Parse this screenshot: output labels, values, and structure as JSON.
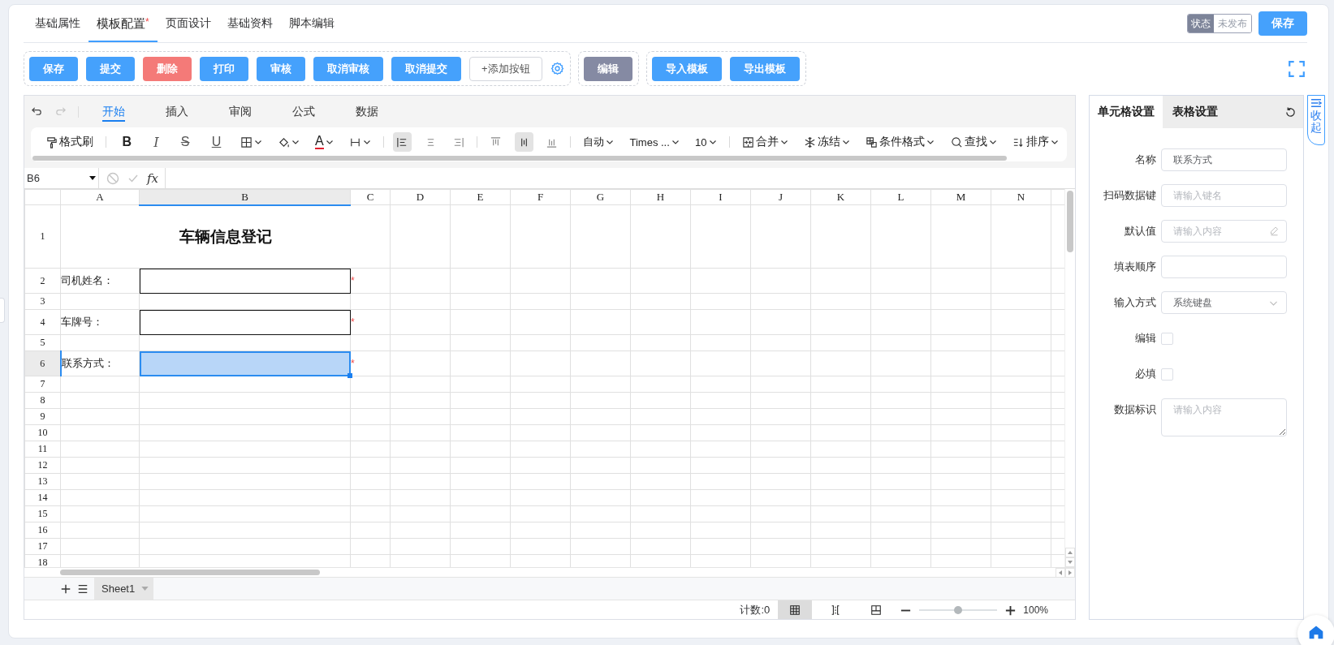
{
  "top_tabs": [
    {
      "label": "基础属性",
      "selected": false
    },
    {
      "label": "模板配置",
      "mark": "*",
      "selected": true
    },
    {
      "label": "页面设计",
      "selected": false
    },
    {
      "label": "基础资料",
      "selected": false
    },
    {
      "label": "脚本编辑",
      "selected": false
    }
  ],
  "status_badge": {
    "label": "状态",
    "value": "未发布"
  },
  "save_button": "保存",
  "button_groups": [
    {
      "buttons": [
        {
          "label": "保存",
          "kind": "primary"
        },
        {
          "label": "提交",
          "kind": "primary"
        },
        {
          "label": "删除",
          "kind": "danger"
        },
        {
          "label": "打印",
          "kind": "primary"
        },
        {
          "label": "审核",
          "kind": "primary"
        },
        {
          "label": "取消审核",
          "kind": "primary"
        },
        {
          "label": "取消提交",
          "kind": "primary"
        },
        {
          "label": "+添加按钮",
          "kind": "outline"
        },
        {
          "kind": "settings"
        }
      ]
    },
    {
      "buttons": [
        {
          "label": "编辑",
          "kind": "muted"
        }
      ]
    },
    {
      "buttons": [
        {
          "label": "导入模板",
          "kind": "primary"
        },
        {
          "label": "导出模板",
          "kind": "primary"
        }
      ]
    }
  ],
  "spreadsheet": {
    "undo_disabled": false,
    "redo_disabled": true,
    "ribbon_tabs": [
      {
        "label": "开始",
        "selected": true
      },
      {
        "label": "插入",
        "selected": false
      },
      {
        "label": "审阅",
        "selected": false
      },
      {
        "label": "公式",
        "selected": false
      },
      {
        "label": "数据",
        "selected": false
      }
    ],
    "toolbar": [
      {
        "kind": "brush",
        "label": "格式刷",
        "dropdown": false,
        "selected": false
      },
      {
        "kind": "sep"
      },
      {
        "kind": "bold",
        "label": "B",
        "dropdown": false,
        "selected": false
      },
      {
        "kind": "italic",
        "label": "I",
        "dropdown": false,
        "selected": false
      },
      {
        "kind": "strike",
        "label": "S",
        "dropdown": false,
        "selected": false
      },
      {
        "kind": "underline",
        "label": "U",
        "dropdown": false,
        "selected": false
      },
      {
        "kind": "borders",
        "dropdown": true,
        "selected": false
      },
      {
        "kind": "fill",
        "dropdown": true,
        "selected": false
      },
      {
        "kind": "fontcolor",
        "label": "A",
        "dropdown": true,
        "selected": false
      },
      {
        "kind": "wrap",
        "dropdown": true,
        "selected": false
      },
      {
        "kind": "sep"
      },
      {
        "kind": "alignleft",
        "dropdown": false,
        "selected": true
      },
      {
        "kind": "aligncenter",
        "dropdown": false,
        "selected": false
      },
      {
        "kind": "alignright",
        "dropdown": false,
        "selected": false
      },
      {
        "kind": "sep"
      },
      {
        "kind": "valigntop",
        "dropdown": false,
        "selected": false
      },
      {
        "kind": "valignmiddle",
        "dropdown": false,
        "selected": true
      },
      {
        "kind": "valignbottom",
        "dropdown": false,
        "selected": false
      },
      {
        "kind": "sep"
      },
      {
        "kind": "text",
        "label": "自动",
        "dropdown": true,
        "selected": false
      },
      {
        "kind": "text",
        "label": "Times ...",
        "dropdown": true,
        "selected": false
      },
      {
        "kind": "text",
        "label": "10",
        "dropdown": true,
        "selected": false
      },
      {
        "kind": "sep"
      },
      {
        "kind": "merge",
        "label": "合并",
        "dropdown": true,
        "selected": false
      },
      {
        "kind": "freeze",
        "label": "冻结",
        "dropdown": true,
        "selected": false
      },
      {
        "kind": "conditional",
        "label": "条件格式",
        "dropdown": true,
        "selected": false
      },
      {
        "kind": "find",
        "label": "查找",
        "dropdown": true,
        "selected": false
      },
      {
        "kind": "sort",
        "label": "排序",
        "dropdown": true,
        "selected": false
      }
    ],
    "name_box": "B6",
    "formula_label": "fx",
    "columns": [
      {
        "label": "A",
        "selected": false
      },
      {
        "label": "B",
        "selected": true
      },
      {
        "label": "C",
        "selected": false
      },
      {
        "label": "D",
        "selected": false
      },
      {
        "label": "E",
        "selected": false
      },
      {
        "label": "F",
        "selected": false
      },
      {
        "label": "G",
        "selected": false
      },
      {
        "label": "H",
        "selected": false
      },
      {
        "label": "I",
        "selected": false
      },
      {
        "label": "J",
        "selected": false
      },
      {
        "label": "K",
        "selected": false
      },
      {
        "label": "L",
        "selected": false
      },
      {
        "label": "M",
        "selected": false
      },
      {
        "label": "N",
        "selected": false
      }
    ],
    "rows": [
      {
        "label": "1",
        "kind": "title",
        "text": "车辆信息登记",
        "selected": false
      },
      {
        "label": "2",
        "kind": "field",
        "text": "司机姓名：",
        "mark": "*",
        "selected": false
      },
      {
        "label": "3",
        "kind": "blank",
        "selected": false
      },
      {
        "label": "4",
        "kind": "field",
        "text": "车牌号：",
        "mark": "*",
        "selected": false
      },
      {
        "label": "5",
        "kind": "blank",
        "selected": false
      },
      {
        "label": "6",
        "kind": "field",
        "text": "联系方式：",
        "mark": "*",
        "selected": true
      },
      {
        "label": "7",
        "kind": "blank",
        "selected": false
      },
      {
        "label": "8",
        "kind": "blank",
        "selected": false
      },
      {
        "label": "9",
        "kind": "blank",
        "selected": false
      },
      {
        "label": "10",
        "kind": "blank",
        "selected": false
      },
      {
        "label": "11",
        "kind": "blank",
        "selected": false
      },
      {
        "label": "12",
        "kind": "blank",
        "selected": false
      },
      {
        "label": "13",
        "kind": "blank",
        "selected": false
      },
      {
        "label": "14",
        "kind": "blank",
        "selected": false
      },
      {
        "label": "15",
        "kind": "blank",
        "selected": false
      },
      {
        "label": "16",
        "kind": "blank",
        "selected": false
      },
      {
        "label": "17",
        "kind": "blank",
        "selected": false
      },
      {
        "label": "18",
        "kind": "blank",
        "selected": false
      }
    ],
    "sheets": [
      {
        "label": "Sheet1",
        "selected": true
      }
    ],
    "status": {
      "count": "计数:0",
      "view_modes": [
        {
          "kind": "normal",
          "selected": true
        },
        {
          "kind": "pagebreak",
          "selected": false
        },
        {
          "kind": "layout",
          "selected": false
        }
      ],
      "zoom": {
        "level": 0.5,
        "reading": "100%"
      }
    }
  },
  "panel": {
    "tabs": [
      {
        "label": "单元格设置",
        "selected": true
      },
      {
        "label": "表格设置",
        "selected": false
      }
    ],
    "fields": [
      {
        "label": "名称",
        "kind": "input",
        "value": "联系方式"
      },
      {
        "label": "扫码数据键",
        "kind": "input",
        "placeholder": "请输入键名"
      },
      {
        "label": "默认值",
        "kind": "input-edit",
        "placeholder": "请输入内容"
      },
      {
        "label": "填表顺序",
        "kind": "input"
      },
      {
        "label": "输入方式",
        "kind": "select",
        "value": "系统键盘"
      },
      {
        "label": "编辑",
        "kind": "checkbox",
        "checked": false
      },
      {
        "label": "必填",
        "kind": "checkbox",
        "checked": false
      },
      {
        "label": "数据标识",
        "kind": "textarea",
        "placeholder": "请输入内容"
      }
    ]
  },
  "collapse_label": "收起"
}
